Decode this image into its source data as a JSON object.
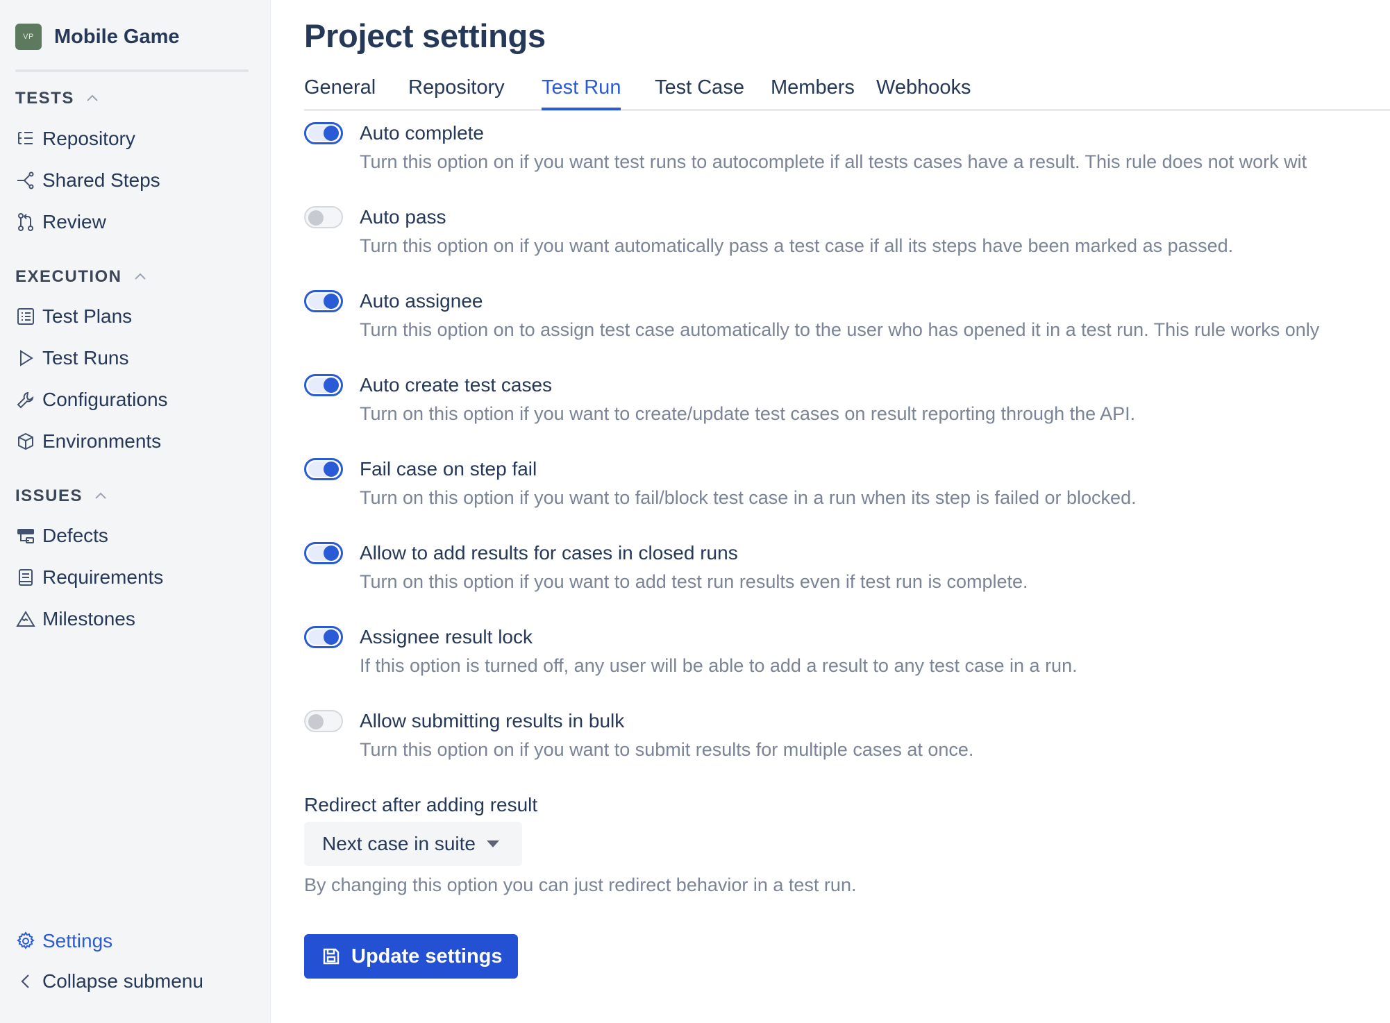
{
  "project": {
    "avatar_text": "VP",
    "name": "Mobile Game"
  },
  "sidebar": {
    "sections": [
      {
        "title": "TESTS",
        "items": [
          {
            "label": "Repository",
            "icon": "repository-tree-icon"
          },
          {
            "label": "Shared Steps",
            "icon": "shared-steps-icon"
          },
          {
            "label": "Review",
            "icon": "pull-request-icon"
          }
        ]
      },
      {
        "title": "EXECUTION",
        "items": [
          {
            "label": "Test Plans",
            "icon": "list-icon"
          },
          {
            "label": "Test Runs",
            "icon": "play-icon"
          },
          {
            "label": "Configurations",
            "icon": "wrench-icon"
          },
          {
            "label": "Environments",
            "icon": "box-icon"
          }
        ]
      },
      {
        "title": "ISSUES",
        "items": [
          {
            "label": "Defects",
            "icon": "defects-icon"
          },
          {
            "label": "Requirements",
            "icon": "document-icon"
          },
          {
            "label": "Milestones",
            "icon": "mountain-icon"
          }
        ]
      }
    ],
    "settings_label": "Settings",
    "collapse_label": "Collapse submenu"
  },
  "page": {
    "title": "Project settings"
  },
  "tabs": [
    {
      "label": "General",
      "active": false
    },
    {
      "label": "Repository",
      "active": false
    },
    {
      "label": "Test Run",
      "active": true
    },
    {
      "label": "Test Case",
      "active": false
    },
    {
      "label": "Members",
      "active": false
    },
    {
      "label": "Webhooks",
      "active": false
    }
  ],
  "options": [
    {
      "title": "Auto complete",
      "enabled": true,
      "description": "Turn this option on if you want test runs to autocomplete if all tests cases have a result. This rule does not work wit"
    },
    {
      "title": "Auto pass",
      "enabled": false,
      "description": "Turn this option on if you want automatically pass a test case if all its steps have been marked as passed."
    },
    {
      "title": "Auto assignee",
      "enabled": true,
      "description": "Turn this option on to assign test case automatically to the user who has opened it in a test run. This rule works only"
    },
    {
      "title": "Auto create test cases",
      "enabled": true,
      "description": "Turn on this option if you want to create/update test cases on result reporting through the API."
    },
    {
      "title": "Fail case on step fail",
      "enabled": true,
      "description": "Turn on this option if you want to fail/block test case in a run when its step is failed or blocked."
    },
    {
      "title": "Allow to add results for cases in closed runs",
      "enabled": true,
      "description": "Turn on this option if you want to add test run results even if test run is complete."
    },
    {
      "title": "Assignee result lock",
      "enabled": true,
      "description": "If this option is turned off, any user will be able to add a result to any test case in a run."
    },
    {
      "title": "Allow submitting results in bulk",
      "enabled": false,
      "description": "Turn this option on if you want to submit results for multiple cases at once."
    }
  ],
  "redirect": {
    "label": "Redirect after adding result",
    "selected": "Next case in suite",
    "help": "By changing this option you can just redirect behavior in a test run."
  },
  "update_button": {
    "label": "Update settings",
    "icon": "save-icon"
  },
  "colors": {
    "accent": "#2a5bd7",
    "button": "#2451d4",
    "sidebar_bg": "#f4f5f7"
  }
}
